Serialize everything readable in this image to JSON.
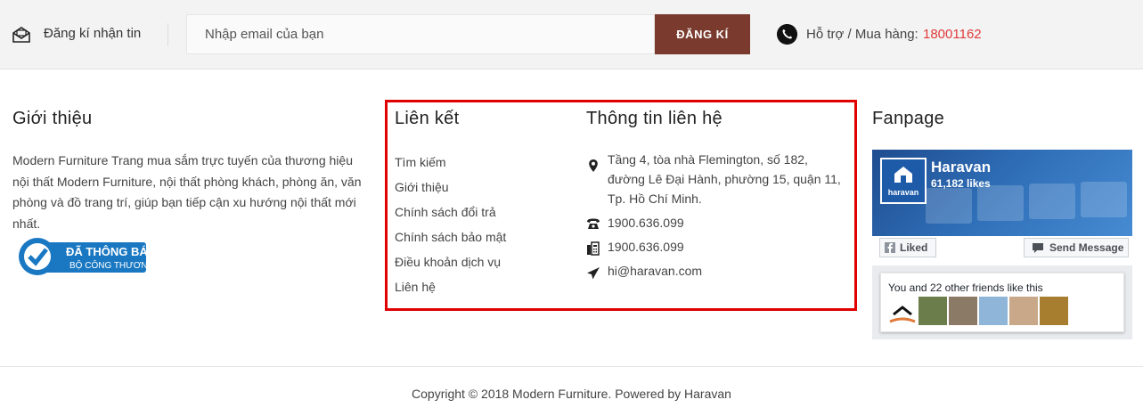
{
  "newsletter": {
    "label": "Đăng kí nhận tin",
    "placeholder": "Nhập email của bạn",
    "button": "ĐĂNG KÍ",
    "support_label": "Hỗ trợ / Mua hàng:",
    "support_number": "18001162",
    "icons": {
      "mail": "mail-subscribe-icon",
      "phone": "phone-icon"
    }
  },
  "intro": {
    "title": "Giới thiệu",
    "text": "Modern Furniture Trang mua sắm trực tuyến của thương hiệu nội thất Modern Furniture, nội thất phòng khách, phòng ăn, văn phòng và đồ trang trí, giúp bạn tiếp cận xu hướng nội thất mới nhất.",
    "badge": {
      "line1": "ĐÃ THÔNG BÁO",
      "line2": "BỘ CÔNG THƯƠNG"
    }
  },
  "links": {
    "title": "Liên kết",
    "items": [
      "Tìm kiếm",
      "Giới thiệu",
      "Chính sách đổi trả",
      "Chính sách bảo mật",
      "Điều khoản dịch vụ",
      "Liên hệ"
    ]
  },
  "contact": {
    "title": "Thông tin liên hệ",
    "address": [
      "Tầng 4, tòa nhà Flemington, số 182,",
      "đường Lê Đại Hành, phường 15, quận 11,",
      "Tp. Hồ Chí Minh."
    ],
    "phone": "1900.636.099",
    "fax": "1900.636.099",
    "email": "hi@haravan.com",
    "icons": {
      "address": "map-pin-icon",
      "phone": "telephone-icon",
      "fax": "fax-icon",
      "email": "paper-plane-icon"
    }
  },
  "fanpage": {
    "title": "Fanpage",
    "page_name": "Haravan",
    "likes": "61,182 likes",
    "logo_text": "haravan",
    "liked_label": "Liked",
    "send_label": "Send Message",
    "friends_text": "You and 22 other friends like this"
  },
  "footer": {
    "copyright": "Copyright © 2018 Modern Furniture. Powered by Haravan"
  },
  "colors": {
    "accent": "#7a3b2e",
    "support_number": "#e03b3b",
    "highlight": "#e00000",
    "facebook_blue": "#1d5aa8"
  }
}
